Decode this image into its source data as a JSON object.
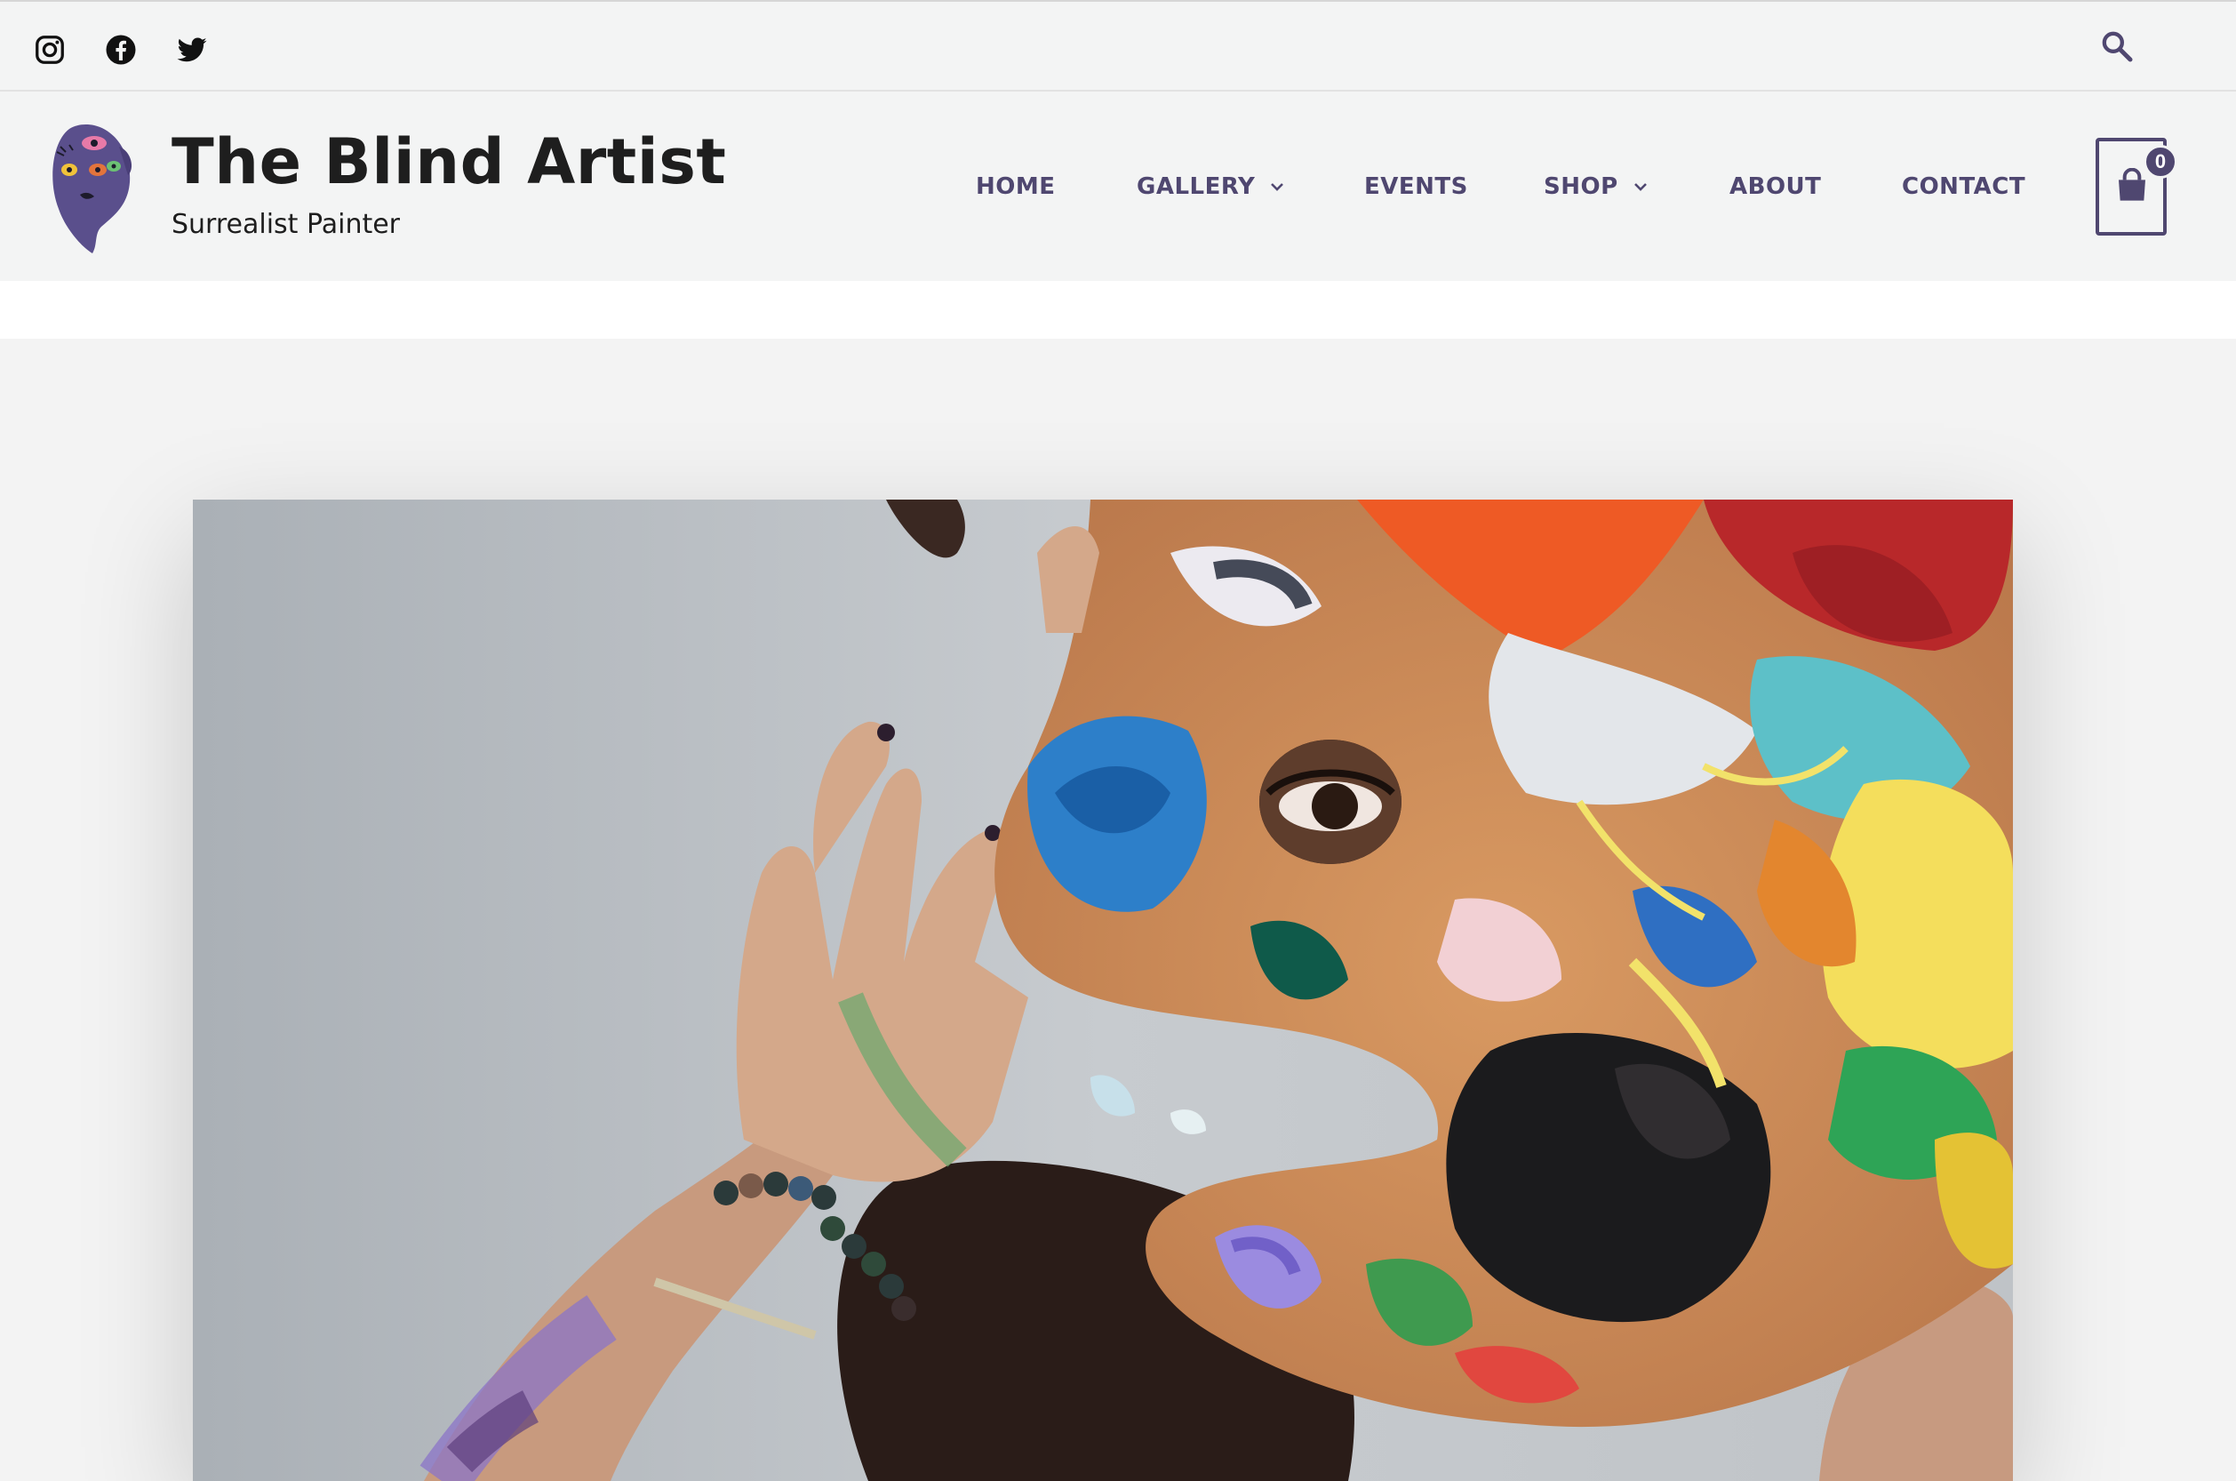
{
  "topbar": {
    "social": [
      {
        "name": "instagram-icon",
        "label": "Instagram"
      },
      {
        "name": "facebook-icon",
        "label": "Facebook"
      },
      {
        "name": "twitter-icon",
        "label": "Twitter"
      }
    ],
    "search_icon": "search-icon"
  },
  "header": {
    "site_title": "The Blind Artist",
    "tagline": "Surrealist Painter"
  },
  "nav": {
    "items": [
      {
        "label": "HOME",
        "has_dropdown": false
      },
      {
        "label": "GALLERY",
        "has_dropdown": true
      },
      {
        "label": "EVENTS",
        "has_dropdown": false
      },
      {
        "label": "SHOP",
        "has_dropdown": true
      },
      {
        "label": "ABOUT",
        "has_dropdown": false
      },
      {
        "label": "CONTACT",
        "has_dropdown": false
      }
    ]
  },
  "cart": {
    "count": "0",
    "icon": "shopping-bag-icon"
  },
  "colors": {
    "accent": "#4f4770",
    "header_bg": "#f3f4f4",
    "page_bg": "#f3f3f3"
  }
}
